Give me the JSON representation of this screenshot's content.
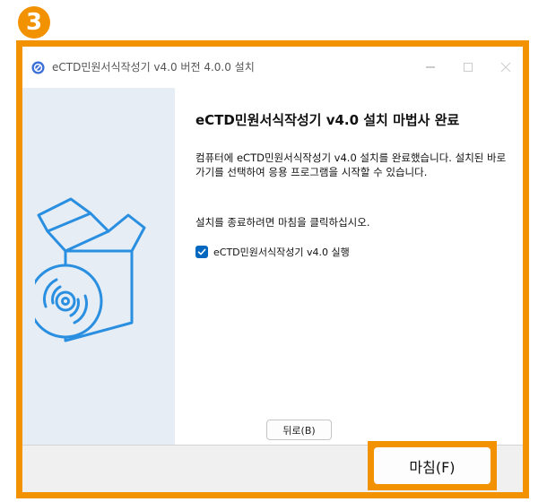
{
  "step": {
    "number": "3"
  },
  "window": {
    "title": "eCTD민원서식작성기 v4.0 버전 4.0.0 설치",
    "icons": [
      "app-icon",
      "minimize-icon",
      "maximize-icon",
      "close-icon"
    ]
  },
  "sidebar": {
    "image": "installer-box-cd-icon"
  },
  "content": {
    "heading": "eCTD민원서식작성기 v4.0 설치 마법사 완료",
    "description": "컴퓨터에 eCTD민원서식작성기 v4.0 설치를 완료했습니다. 설치된 바로가기를 선택하여 응용 프로그램을 시작할 수 있습니다.",
    "instruction": "설치를 종료하려면 마침을 클릭하십시오.",
    "run_checkbox": {
      "label": "eCTD민원서식작성기 v4.0 실행",
      "checked": true
    }
  },
  "buttons": {
    "back": "뒤로(B)",
    "finish": "마침(F)"
  },
  "colors": {
    "highlight": "#f39200",
    "accent": "#0067c0",
    "sidebar": "#e6edf4"
  }
}
